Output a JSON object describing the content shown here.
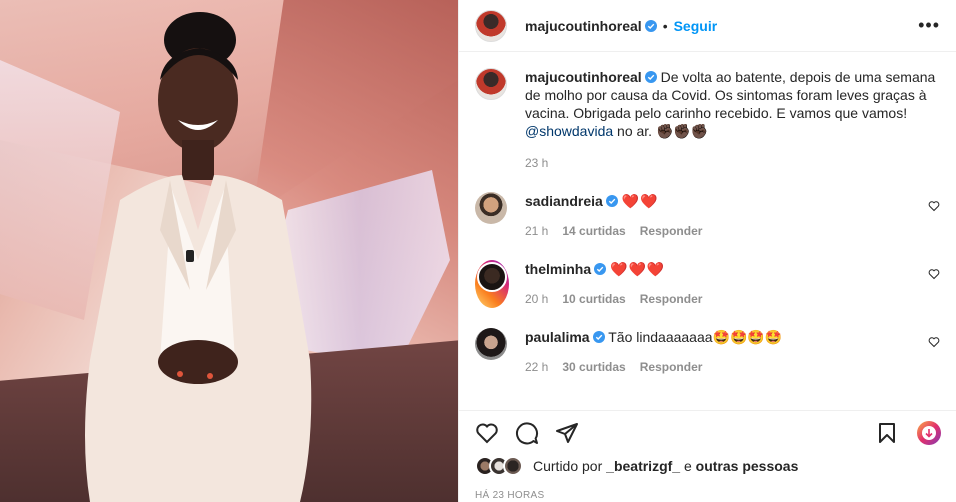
{
  "header": {
    "username": "majucoutinhoreal",
    "dot": "•",
    "follow_label": "Seguir",
    "more_label": "•••"
  },
  "caption": {
    "username": "majucoutinhoreal",
    "text": "De volta ao batente, depois de uma semana de molho por causa da Covid. Os sintomas foram leves graças à vacina. Obrigada pelo carinho recebido. E vamos que vamos!",
    "mention": "@showdavida",
    "suffix": " no ar. ✊🏿✊🏿✊🏿",
    "time": "23 h"
  },
  "comments": [
    {
      "username": "sadiandreia",
      "text": "❤️❤️",
      "time": "21 h",
      "likes": "14 curtidas",
      "reply": "Responder"
    },
    {
      "username": "thelminha",
      "text": "❤️❤️❤️",
      "time": "20 h",
      "likes": "10 curtidas",
      "reply": "Responder"
    },
    {
      "username": "paulalima",
      "text": "Tão lindaaaaaaa🤩🤩🤩🤩",
      "time": "22 h",
      "likes": "30 curtidas",
      "reply": "Responder"
    }
  ],
  "likes": {
    "prefix": "Curtido por",
    "user": "_beatrizgf_",
    "and": "e",
    "others": "outras pessoas"
  },
  "date": "HÁ 23 HORAS",
  "colors": {
    "accent": "#0095f6",
    "text": "#262626",
    "muted": "#8e8e8e",
    "heart": "#ed4956"
  }
}
